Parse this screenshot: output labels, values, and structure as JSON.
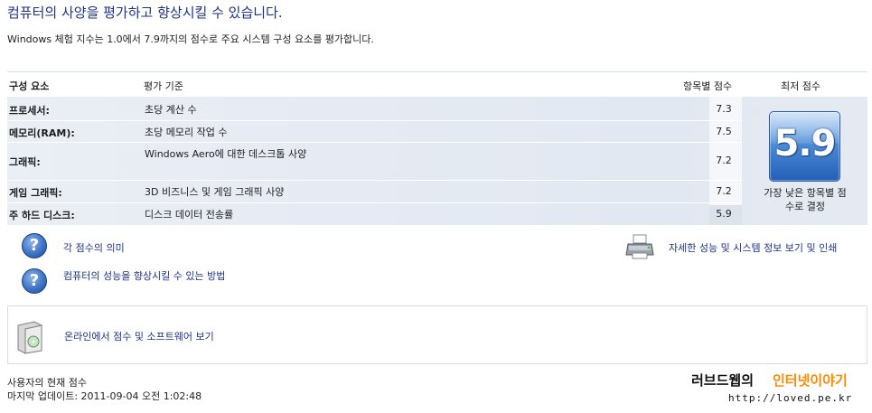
{
  "header": {
    "title": "컴퓨터의 사양을 평가하고 향상시킬 수 있습니다.",
    "subtitle": "Windows 체험 지수는 1.0에서 7.9까지의 점수로 주요 시스템 구성 요소를 평가합니다."
  },
  "table": {
    "columns": {
      "component": "구성 요소",
      "criteria": "평가 기준",
      "subscore": "항목별 점수",
      "basescore": "최저 점수"
    },
    "rows": [
      {
        "component": "프로세서:",
        "criteria": "초당 계산 수",
        "score": "7.3"
      },
      {
        "component": "메모리(RAM):",
        "criteria": "초당 메모리 작업 수",
        "score": "7.5"
      },
      {
        "component": "그래픽:",
        "criteria": "Windows Aero에 대한 데스크톱 사양",
        "score": "7.2"
      },
      {
        "component": "게임 그래픽:",
        "criteria": "3D 비즈니스 및 게임 그래픽 사양",
        "score": "7.2"
      },
      {
        "component": "주 하드 디스크:",
        "criteria": "디스크 데이터 전송률",
        "score": "5.9"
      }
    ],
    "base_score": "5.9",
    "base_caption": "가장 낮은 항목별 점수로 결정"
  },
  "links": {
    "score_meaning": "각 점수의 의미",
    "improve": "컴퓨터의 성능을 향상시킬 수 있는 방법",
    "details_print": "자세한 성능 및 시스템 정보 보기 및 인쇄",
    "online": "온라인에서 점수 및 소프트웨어 보기"
  },
  "footer": {
    "current_score": "사용자의 현재 점수",
    "last_update": "마지막 업데이트: 2011-09-04 오전 1:02:48"
  },
  "watermark": {
    "part1": "러브드웹의",
    "part2": "인터넷이야기",
    "url": "http://loved.pe.kr"
  },
  "icons": {
    "help": "help-question-icon",
    "printer": "printer-icon",
    "software_box": "software-box-icon"
  },
  "colors": {
    "title": "#1e3287",
    "link": "#1e3287",
    "base_score_tile": "#3d7ccf",
    "table_bg": "#e5eaf2"
  }
}
